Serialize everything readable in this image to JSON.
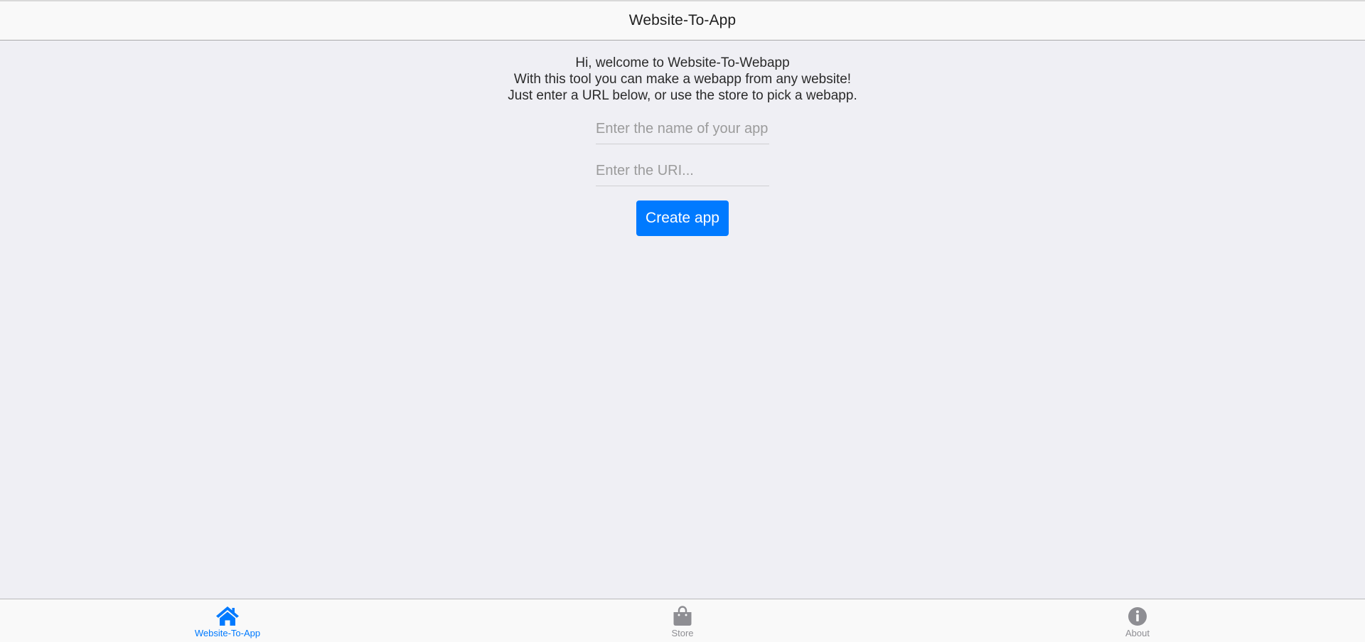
{
  "toolbar": {
    "title": "Website-To-App"
  },
  "intro": {
    "line1": "Hi, welcome to Website-To-Webapp",
    "line2": "With this tool you can make a webapp from any website!",
    "line3": "Just enter a URL below, or use the store to pick a webapp."
  },
  "form": {
    "name_value": "",
    "name_placeholder": "Enter the name of your app",
    "uri_value": "",
    "uri_placeholder": "Enter the URI...",
    "create_label": "Create app"
  },
  "tabs": [
    {
      "label": "Website-To-App",
      "icon": "home-icon",
      "active": true
    },
    {
      "label": "Store",
      "icon": "shopping-bag-icon",
      "active": false
    },
    {
      "label": "About",
      "icon": "info-icon",
      "active": false
    }
  ],
  "colors": {
    "accent": "#007aff",
    "inactive_tab": "#8e8e93",
    "background": "#efeff4",
    "bar_background": "#f9f9f9"
  }
}
